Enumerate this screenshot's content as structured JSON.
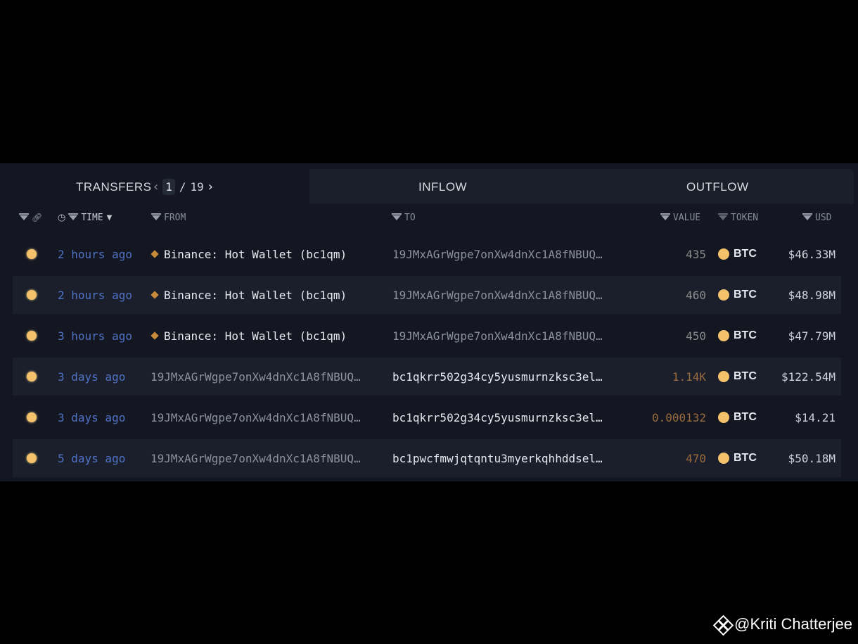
{
  "tabs": {
    "transfers": "TRANSFERS",
    "inflow": "INFLOW",
    "outflow": "OUTFLOW"
  },
  "pager": {
    "prev": "‹",
    "current": "1",
    "separator": "/",
    "total": "19",
    "next": "›"
  },
  "columns": {
    "time": "TIME",
    "from": "FROM",
    "to": "TO",
    "value": "VALUE",
    "token": "TOKEN",
    "usd": "USD"
  },
  "rows": [
    {
      "time": "2 hours ago",
      "from": "Binance: Hot Wallet (bc1qm)",
      "to": "19JMxAGrWgpe7onXw4dnXc1A8fNBUQ…",
      "value": "435",
      "token": "BTC",
      "usd": "$46.33M"
    },
    {
      "time": "2 hours ago",
      "from": "Binance: Hot Wallet (bc1qm)",
      "to": "19JMxAGrWgpe7onXw4dnXc1A8fNBUQ…",
      "value": "460",
      "token": "BTC",
      "usd": "$48.98M"
    },
    {
      "time": "3 hours ago",
      "from": "Binance: Hot Wallet (bc1qm)",
      "to": "19JMxAGrWgpe7onXw4dnXc1A8fNBUQ…",
      "value": "450",
      "token": "BTC",
      "usd": "$47.79M"
    },
    {
      "time": "3 days ago",
      "from": "19JMxAGrWgpe7onXw4dnXc1A8fNBUQ…",
      "to": "bc1qkrr502g34cy5yusmurnzksc3el…",
      "value": "1.14K",
      "token": "BTC",
      "usd": "$122.54M"
    },
    {
      "time": "3 days ago",
      "from": "19JMxAGrWgpe7onXw4dnXc1A8fNBUQ…",
      "to": "bc1qkrr502g34cy5yusmurnzksc3el…",
      "value": "0.000132",
      "token": "BTC",
      "usd": "$14.21"
    },
    {
      "time": "5 days ago",
      "from": "19JMxAGrWgpe7onXw4dnXc1A8fNBUQ…",
      "to": "bc1pwcfmwjqtqntu3myerkqhhddsel…",
      "value": "470",
      "token": "BTC",
      "usd": "$50.18M"
    }
  ],
  "watermark": "@Kriti Chatterjee",
  "colors": {
    "background": "#000000",
    "panel": "#141722",
    "link": "#4f72c4",
    "btc": "#f4c26b",
    "exchange": "#c98b3a"
  }
}
